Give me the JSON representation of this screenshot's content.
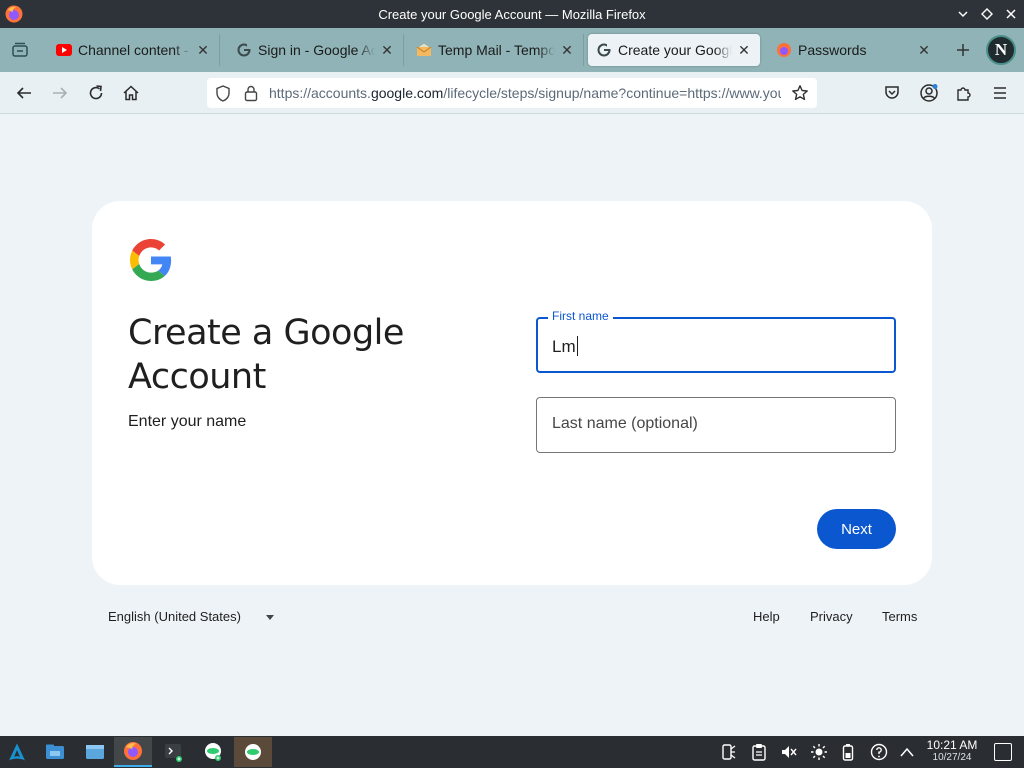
{
  "window": {
    "title": "Create your Google Account — Mozilla Firefox"
  },
  "tabs": [
    {
      "title": "Channel content - YouTube",
      "icon": "youtube-icon"
    },
    {
      "title": "Sign in - Google Accounts",
      "icon": "google-icon"
    },
    {
      "title": "Temp Mail - Temporary Email",
      "icon": "envelope-icon"
    },
    {
      "title": "Create your Google Account",
      "icon": "google-icon",
      "active": true
    },
    {
      "title": "Passwords",
      "icon": "firefox-icon"
    }
  ],
  "urlbar": {
    "url_prefix": "https://accounts.",
    "url_domain": "google.com",
    "url_suffix": "/lifecycle/steps/signup/name?continue=https://www.youtube.com"
  },
  "signup": {
    "title": "Create a Google Account",
    "subtitle": "Enter your name",
    "first_name_label": "First name",
    "first_name_value": "Lm",
    "last_name_placeholder": "Last name (optional)",
    "next_label": "Next"
  },
  "footer": {
    "language": "English (United States)",
    "help": "Help",
    "privacy": "Privacy",
    "terms": "Terms"
  },
  "taskbar": {
    "time": "10:21 AM",
    "date": "10/27/24"
  },
  "colors": {
    "accent_blue": "#0b57d0",
    "tab_bar": "#8fb3b6",
    "page_bg": "#eef3f8",
    "taskbar": "#2a2e32"
  }
}
